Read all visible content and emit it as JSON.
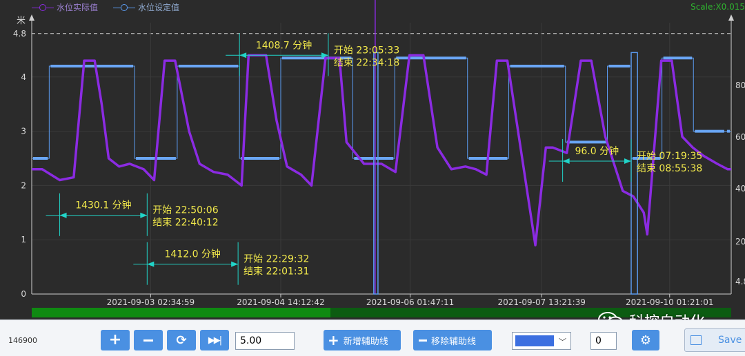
{
  "legend": {
    "actual_label": "水位实际值",
    "set_label": "水位设定值",
    "actual_color": "#8b2be2",
    "set_color": "#5b9bf0"
  },
  "scale_text": "Scale:X0.015",
  "chart_data": {
    "type": "line",
    "y_unit": "米",
    "ylim": [
      0,
      5
    ],
    "y_ticks_left": [
      "0",
      "1",
      "2",
      "3",
      "4",
      "4.8"
    ],
    "y_ticks_right": [
      "4.8",
      "20",
      "40",
      "60",
      "80"
    ],
    "dashed_reference": 4.8,
    "x_tick_labels": [
      "2021-09-03 02:34:59",
      "2021-09-04 14:12:42",
      "2021-09-06 01:47:11",
      "2021-09-07 13:21:39",
      "2021-09-10 01:21:01"
    ],
    "x_range_fraction": [
      0,
      1
    ],
    "series": [
      {
        "name": "水位设定值",
        "step": true,
        "x": [
          0.0,
          0.025,
          0.147,
          0.208,
          0.297,
          0.356,
          0.459,
          0.519,
          0.623,
          0.682,
          0.763,
          0.823,
          0.857,
          0.901,
          0.946,
          0.992,
          1.0
        ],
        "y": [
          2.5,
          4.2,
          2.5,
          4.2,
          2.5,
          4.35,
          2.5,
          4.35,
          2.5,
          4.2,
          2.8,
          4.2,
          2.5,
          4.35,
          3.0,
          3.0,
          3.0
        ]
      },
      {
        "name": "水位实际值",
        "x": [
          0.0,
          0.015,
          0.04,
          0.06,
          0.075,
          0.09,
          0.1,
          0.11,
          0.125,
          0.14,
          0.16,
          0.175,
          0.19,
          0.205,
          0.225,
          0.24,
          0.26,
          0.28,
          0.3,
          0.31,
          0.335,
          0.35,
          0.365,
          0.385,
          0.4,
          0.42,
          0.44,
          0.45,
          0.475,
          0.49,
          0.5,
          0.52,
          0.54,
          0.56,
          0.58,
          0.6,
          0.62,
          0.635,
          0.65,
          0.665,
          0.68,
          0.7,
          0.72,
          0.735,
          0.745,
          0.765,
          0.785,
          0.8,
          0.82,
          0.845,
          0.86,
          0.875,
          0.88,
          0.9,
          0.915,
          0.93,
          0.945,
          0.96,
          0.98,
          0.995,
          1.0
        ],
        "y": [
          2.3,
          2.3,
          2.1,
          2.15,
          4.3,
          4.3,
          3.5,
          2.5,
          2.35,
          2.4,
          2.3,
          2.1,
          4.3,
          4.3,
          3.0,
          2.4,
          2.25,
          2.2,
          2.0,
          4.4,
          4.4,
          3.2,
          2.35,
          2.2,
          2.0,
          4.35,
          4.35,
          2.8,
          2.4,
          2.4,
          2.4,
          2.25,
          4.4,
          4.4,
          2.7,
          2.3,
          2.35,
          2.3,
          2.2,
          4.3,
          4.3,
          2.6,
          0.9,
          2.7,
          2.7,
          2.6,
          4.3,
          4.3,
          2.9,
          1.9,
          1.8,
          1.5,
          1.1,
          4.3,
          4.3,
          2.9,
          2.7,
          2.55,
          2.4,
          2.3,
          2.3
        ]
      }
    ],
    "annotations": [
      {
        "duration": "1430.1 分钟",
        "start": "开始 22:50:06",
        "end": "结束 22:40:12",
        "x1": 0.04,
        "x2": 0.165,
        "y": 1.45
      },
      {
        "duration": "1412.0 分钟",
        "start": "开始 22:29:32",
        "end": "结束 22:01:31",
        "x1": 0.165,
        "x2": 0.295,
        "y": 0.55
      },
      {
        "duration": "1408.7 分钟",
        "start": "开始 23:05:33",
        "end": "结束 22:34:18",
        "x1": 0.297,
        "x2": 0.424,
        "y": 4.4
      },
      {
        "duration": "96.0 分钟",
        "start": "开始 07:19:35",
        "end": "结束 08:55:38",
        "x1": 0.759,
        "x2": 0.857,
        "y": 2.45
      }
    ],
    "cursor_x": 0.491,
    "gap_x": [
      0.489,
      0.495,
      0.857,
      0.866
    ],
    "progress": 0.427
  },
  "toolbar": {
    "count": "146900",
    "zoom_value": "5.00",
    "add_guide_label": "新增辅助线",
    "remove_guide_label": "移除辅助线",
    "index_value": "0",
    "save_label": "Save"
  },
  "watermark": "科控自动化"
}
